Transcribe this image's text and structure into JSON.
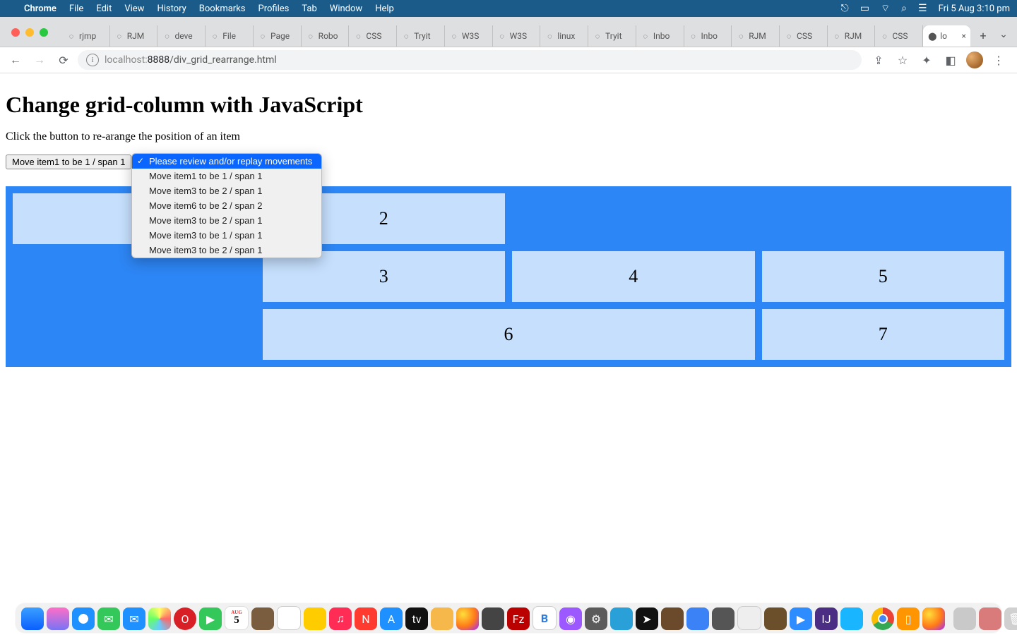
{
  "menubar": {
    "app": "Chrome",
    "items": [
      "File",
      "Edit",
      "View",
      "History",
      "Bookmarks",
      "Profiles",
      "Tab",
      "Window",
      "Help"
    ],
    "clock": "Fri 5 Aug  3:10 pm"
  },
  "tabs": {
    "items": [
      {
        "label": "rjmp"
      },
      {
        "label": "RJM"
      },
      {
        "label": "deve"
      },
      {
        "label": "File"
      },
      {
        "label": "Page"
      },
      {
        "label": "Robo"
      },
      {
        "label": "CSS"
      },
      {
        "label": "Tryit"
      },
      {
        "label": "W3S"
      },
      {
        "label": "W3S"
      },
      {
        "label": "linux"
      },
      {
        "label": "Tryit"
      },
      {
        "label": "Inbo"
      },
      {
        "label": "Inbo"
      },
      {
        "label": "RJM"
      },
      {
        "label": "CSS"
      },
      {
        "label": "RJM"
      },
      {
        "label": "CSS"
      }
    ],
    "active": {
      "label": "lo"
    }
  },
  "omnibox": {
    "host_dim": "localhost:",
    "host_port": "8888",
    "path": "/div_grid_rearrange.html"
  },
  "page": {
    "heading": "Change grid-column with JavaScript",
    "desc": "Click the button to re-arange the position of an item",
    "button_label": "Move item1 to be 1 / span 1",
    "dropdown": {
      "selected_index": 0,
      "options": [
        "Please review and/or replay movements",
        "Move item1 to be 1 / span 1",
        "Move item3 to be 2 / span 1",
        "Move item6 to be 2 / span 2",
        "Move item3 to be 2 / span 1",
        "Move item3 to be 1 / span 1",
        "Move item3 to be 2 / span 1"
      ]
    },
    "grid_cells": [
      "",
      "2",
      "3",
      "4",
      "5",
      "6",
      "7"
    ]
  },
  "dock": {
    "calendar_month": "AUG",
    "calendar_day": "5"
  }
}
